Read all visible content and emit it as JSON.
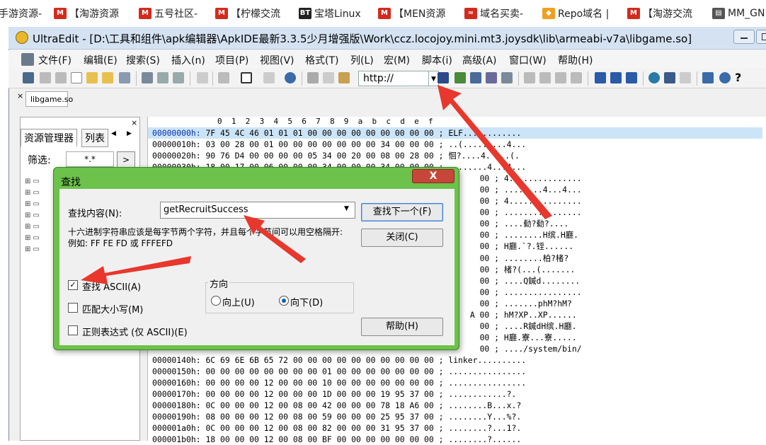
{
  "bookmarks": [
    {
      "label": "手游资源-",
      "icon": "",
      "color": ""
    },
    {
      "label": "【淘游资源",
      "icon": "M",
      "color": "#d32a1e"
    },
    {
      "label": "五号社区-",
      "icon": "M",
      "color": "#d32a1e"
    },
    {
      "label": "【柠檬交流",
      "icon": "M",
      "color": "#d32a1e"
    },
    {
      "label": "宝塔Linux",
      "icon": "BT",
      "color": "#222222"
    },
    {
      "label": "【MEN资源",
      "icon": "M",
      "color": "#d32a1e"
    },
    {
      "label": "域名买卖-",
      "icon": "≈",
      "color": "#d32a1e"
    },
    {
      "label": "Repo域名 |",
      "icon": "◆",
      "color": "#f0a020"
    },
    {
      "label": "【淘游交流",
      "icon": "M",
      "color": "#d32a1e"
    },
    {
      "label": "MM_GN",
      "icon": "▤",
      "color": "#555555"
    }
  ],
  "window": {
    "title": "UltraEdit - [D:\\工具和组件\\apk编辑器\\ApkIDE最新3.3.5少月增强版\\Work\\ccz.locojoy.mini.mt3.joysdk\\lib\\armeabi-v7a\\libgame.so]"
  },
  "menu": [
    "文件(F)",
    "编辑(E)",
    "搜索(S)",
    "插入(n)",
    "项目(P)",
    "视图(V)",
    "格式(T)",
    "列(L)",
    "宏(M)",
    "脚本(i)",
    "高级(A)",
    "窗口(W)",
    "帮助(H)"
  ],
  "toolbar": {
    "url_value": "http://"
  },
  "file_tab": "libgame.so",
  "left_panel": {
    "tab_explorer": "资源管理器",
    "tab_list": "列表",
    "filter_label": "筛选:",
    "filter_value": "*.*",
    "filter_go": ">"
  },
  "hex": {
    "ruler": "0  1  2  3  4  5  6  7  8  9  a  b  c  d  e  f",
    "rows": [
      {
        "addr": "00000000h:",
        "bytes": "7F 45 4C 46 01 01 01 00 00 00 00 00 00 00 00 00",
        "ascii": "ELF............"
      },
      {
        "addr": "00000010h:",
        "bytes": "03 00 28 00 01 00 00 00 00 00 00 00 34 00 00 00",
        "ascii": "..(.........4..."
      },
      {
        "addr": "00000020h:",
        "bytes": "90 76 D4 00 00 00 00 05 34 00 20 00 08 00 28 00",
        "ascii": "恛?....4. ...(."
      },
      {
        "addr": "00000030h:",
        "bytes": "18 00 17 00 06 00 00 00 34 00 00 00 34 00 00 00",
        "ascii": "........4...4..."
      },
      {
        "addr": "",
        "bytes": "",
        "ascii": "4..............."
      },
      {
        "addr": "",
        "bytes": "",
        "ascii": "........4...4..."
      },
      {
        "addr": "",
        "bytes": "",
        "ascii": "4..............."
      },
      {
        "addr": "",
        "bytes": "",
        "ascii": "................"
      },
      {
        "addr": "",
        "bytes": "",
        "ascii": "....勬?勬?...."
      },
      {
        "addr": "",
        "bytes": "",
        "ascii": "........H缤.H廳."
      },
      {
        "addr": "",
        "bytes": "",
        "ascii": "H廳.`?.铚......"
      },
      {
        "addr": "",
        "bytes": "",
        "ascii": "........柏?楮?"
      },
      {
        "addr": "",
        "bytes": "",
        "ascii": "楮?(...(......."
      },
      {
        "addr": "",
        "bytes": "",
        "ascii": "....Q鍼d........"
      },
      {
        "addr": "",
        "bytes": "",
        "ascii": "................"
      },
      {
        "addr": "",
        "bytes": "",
        "ascii": ".......phM?hM?"
      },
      {
        "addr": "",
        "bytes": "",
        "ascii": "hM?XP..XP......"
      },
      {
        "addr": "",
        "bytes": "",
        "ascii": "....R鍼dH缤.H廳."
      },
      {
        "addr": "",
        "bytes": "",
        "ascii": "H廳.寮...寮....."
      },
      {
        "addr": "",
        "bytes": "",
        "ascii": "..../system/bin/"
      },
      {
        "addr": "00000140h:",
        "bytes": "6C 69 6E 6B 65 72 00 00 00 00 00 00 00 00 00 00",
        "ascii": "linker.........."
      },
      {
        "addr": "00000150h:",
        "bytes": "00 00 00 00 00 00 00 00 01 00 00 00 00 00 00 00",
        "ascii": "................"
      },
      {
        "addr": "00000160h:",
        "bytes": "00 00 00 00 12 00 00 00 10 00 00 00 00 00 00 00",
        "ascii": "................"
      },
      {
        "addr": "00000170h:",
        "bytes": "00 00 00 00 12 00 00 00 1D 00 00 00 19 95 37 00",
        "ascii": "............?."
      },
      {
        "addr": "00000180h:",
        "bytes": "0C 00 00 00 12 00 08 00 42 00 00 00 78 18 A6 00",
        "ascii": "........B...x.?"
      },
      {
        "addr": "00000190h:",
        "bytes": "08 00 00 00 12 00 08 00 59 00 00 00 25 95 37 00",
        "ascii": "........Y...%?."
      },
      {
        "addr": "000001a0h:",
        "bytes": "0C 00 00 00 12 00 08 00 82 00 00 00 31 95 37 00",
        "ascii": "........?...1?."
      },
      {
        "addr": "000001b0h:",
        "bytes": "18 00 00 00 12 00 08 00 BF 00 00 00 00 00 00 00",
        "ascii": "........?......"
      }
    ],
    "partial_tail": [
      "00 ;",
      "00 ;",
      "00 ;",
      "00 ;",
      "00 ;",
      "00 ;",
      "00 ;",
      "00 ;",
      "00 ;",
      "00 ;",
      "00 ;",
      "00 ;",
      "A 00 ;",
      "00 ;",
      "00 ;",
      "00 ;",
      "2F ;"
    ]
  },
  "dialog": {
    "title": "查找",
    "close_glyph": "X",
    "find_label": "查找内容(N):",
    "find_value": "getRecruitSuccess",
    "hint": "十六进制字符串应该是每字节两个字符，并且每个字节间可以用空格隔开:",
    "example": "例如: FF FE FD 或 FFFEFD",
    "find_next": "查找下一个(F)",
    "close": "关闭(C)",
    "help": "帮助(H)",
    "chk_ascii": "查找 ASCII(A)",
    "chk_case": "匹配大小写(M)",
    "chk_regex": "正则表达式 (仅 ASCII)(E)",
    "direction_label": "方向",
    "dir_up": "向上(U)",
    "dir_down": "向下(D)",
    "check_mark": "✓"
  }
}
